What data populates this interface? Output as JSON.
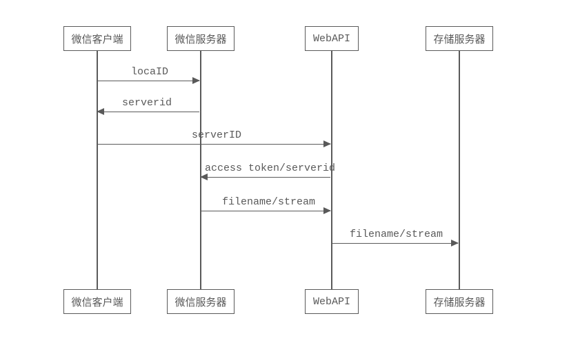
{
  "participants": {
    "p1": "微信客户端",
    "p2": "微信服务器",
    "p3": "WebAPI",
    "p4": "存储服务器"
  },
  "messages": {
    "m1": "locaID",
    "m2": "serverid",
    "m3": "serverID",
    "m4": "access token/serverid",
    "m5": "filename/stream",
    "m6": "filename/stream"
  },
  "chart_data": {
    "type": "table",
    "title": "Sequence Diagram",
    "participants": [
      "微信客户端",
      "微信服务器",
      "WebAPI",
      "存储服务器"
    ],
    "interactions": [
      {
        "from": "微信客户端",
        "to": "微信服务器",
        "label": "locaID"
      },
      {
        "from": "微信服务器",
        "to": "微信客户端",
        "label": "serverid"
      },
      {
        "from": "微信客户端",
        "to": "WebAPI",
        "label": "serverID"
      },
      {
        "from": "WebAPI",
        "to": "微信服务器",
        "label": "access token/serverid"
      },
      {
        "from": "微信服务器",
        "to": "WebAPI",
        "label": "filename/stream"
      },
      {
        "from": "WebAPI",
        "to": "存储服务器",
        "label": "filename/stream"
      }
    ]
  }
}
